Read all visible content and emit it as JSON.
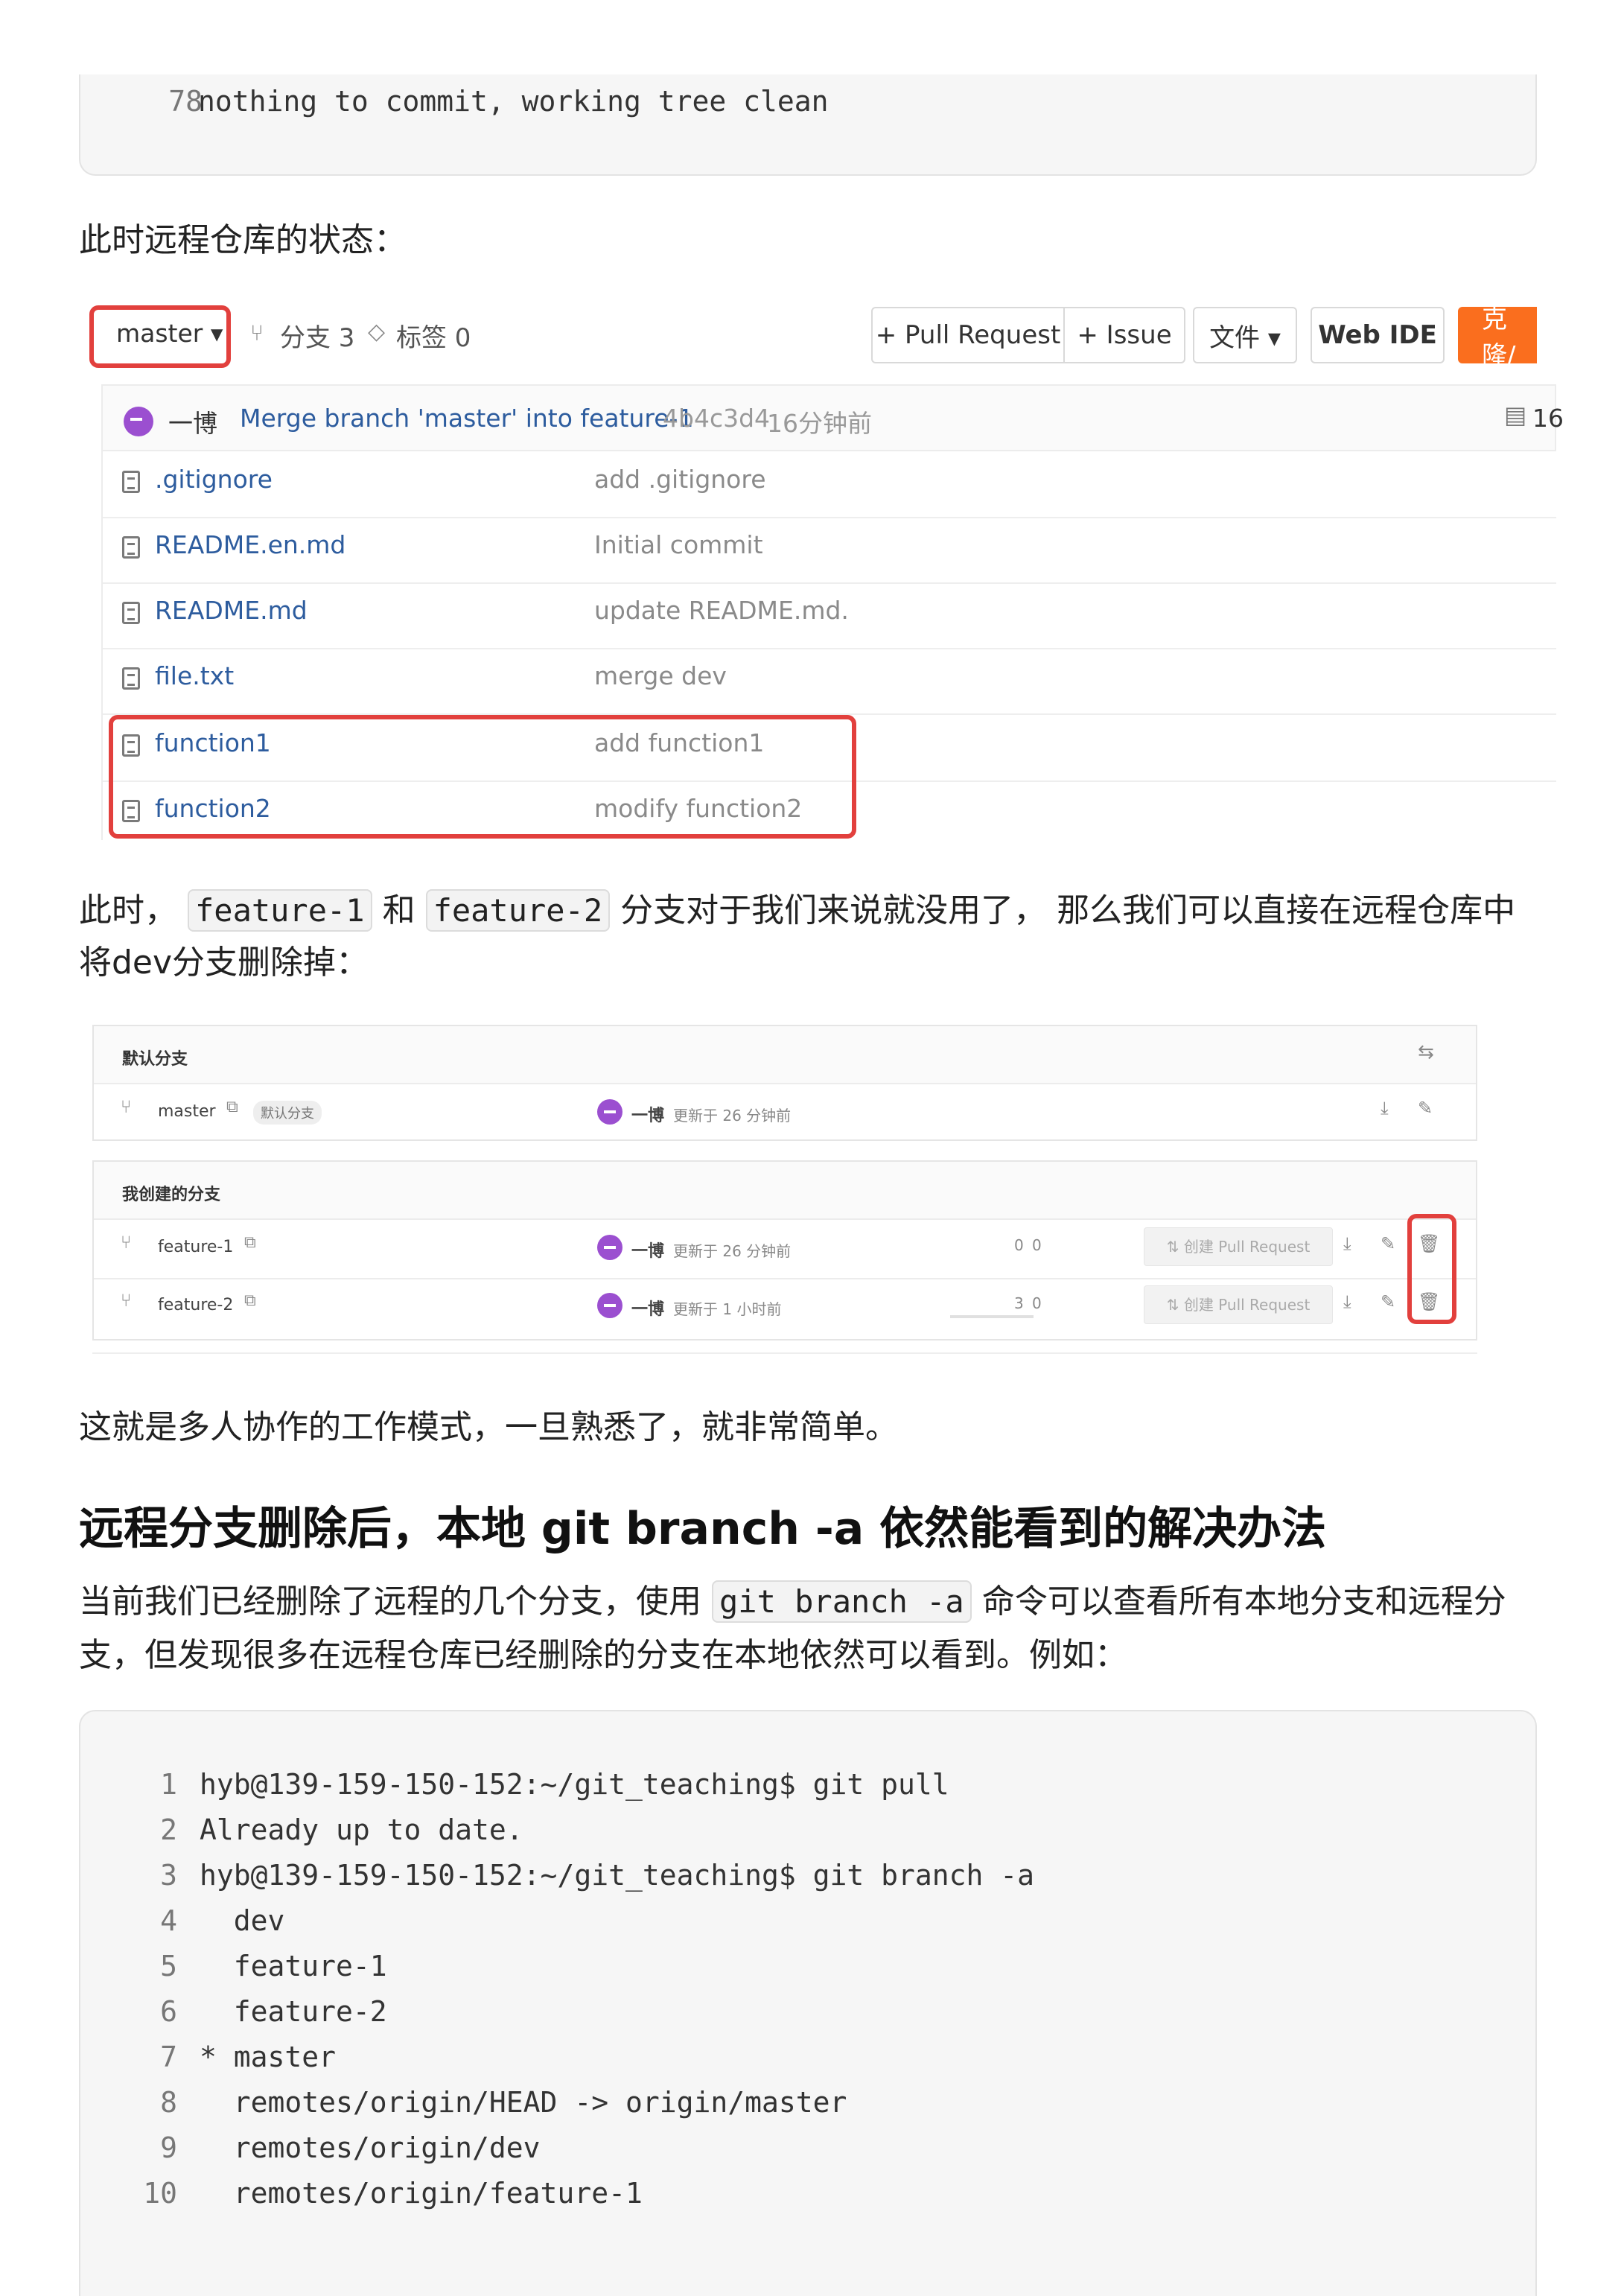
{
  "code_top": {
    "lines": [
      {
        "num": "78",
        "text": "nothing to commit, working tree clean"
      }
    ]
  },
  "para1": "此时远程仓库的状态：",
  "repo": {
    "branch_selector": "master ▾",
    "branches": "分支 3",
    "tags": "标签 0",
    "pull_request": "+ Pull Request",
    "issue": "+ Issue",
    "files": "文件 ▾",
    "web_ide": "Web IDE",
    "clone": "克隆/",
    "commit": {
      "author": "一博",
      "message": "Merge branch 'master' into feature-1",
      "hash": "4b4c3d4",
      "time": "16分钟前",
      "count": "16"
    },
    "files_list": [
      {
        "name": ".gitignore",
        "message": "add .gitignore"
      },
      {
        "name": "README.en.md",
        "message": "Initial commit"
      },
      {
        "name": "README.md",
        "message": "update README.md."
      },
      {
        "name": "file.txt",
        "message": "merge dev"
      },
      {
        "name": "function1",
        "message": "add function1"
      },
      {
        "name": "function2",
        "message": "modify function2"
      }
    ],
    "accent": "#fa6e1e",
    "highlight": "#e2403d"
  },
  "para2": {
    "p1": "此时，",
    "code1": "feature-1",
    "p2": "和",
    "code2": "feature-2",
    "p3": "分支对于我们来说就没用了， 那么我们可以直接在远程仓库中",
    "line2": "将dev分支删除掉："
  },
  "branches_panel": {
    "default_title": "默认分支",
    "default_branch": {
      "name": "master",
      "badge": "默认分支",
      "author": "一博",
      "updated": "更新于 26 分钟前"
    },
    "mine_title": "我创建的分支",
    "mine": [
      {
        "name": "feature-1",
        "author": "一博",
        "updated": "更新于 26 分钟前",
        "behind": "0",
        "ahead": "0",
        "pr": "创建 Pull Request"
      },
      {
        "name": "feature-2",
        "author": "一博",
        "updated": "更新于 1 小时前",
        "behind": "3",
        "ahead": "0",
        "pr": "创建 Pull Request"
      }
    ]
  },
  "para3": "这就是多人协作的工作模式，一旦熟悉了，就非常简单。",
  "heading": "远程分支删除后，本地 git branch -a 依然能看到的解决办法",
  "para4": {
    "p1": "当前我们已经删除了远程的几个分支，使用",
    "code": "git branch -a",
    "p2": "命令可以查看所有本地分支和远程分",
    "line2": "支，但发现很多在远程仓库已经删除的分支在本地依然可以看到。例如："
  },
  "code_bottom": {
    "lines": [
      {
        "num": "1",
        "text": "hyb@139-159-150-152:~/git_teaching$ git pull"
      },
      {
        "num": "2",
        "text": "Already up to date."
      },
      {
        "num": "3",
        "text": "hyb@139-159-150-152:~/git_teaching$ git branch -a"
      },
      {
        "num": "4",
        "text": "  dev"
      },
      {
        "num": "5",
        "text": "  feature-1"
      },
      {
        "num": "6",
        "text": "  feature-2"
      },
      {
        "num": "7",
        "text": "* master"
      },
      {
        "num": "8",
        "text": "  remotes/origin/HEAD -> origin/master"
      },
      {
        "num": "9",
        "text": "  remotes/origin/dev"
      },
      {
        "num": "10",
        "text": "  remotes/origin/feature-1"
      }
    ]
  }
}
